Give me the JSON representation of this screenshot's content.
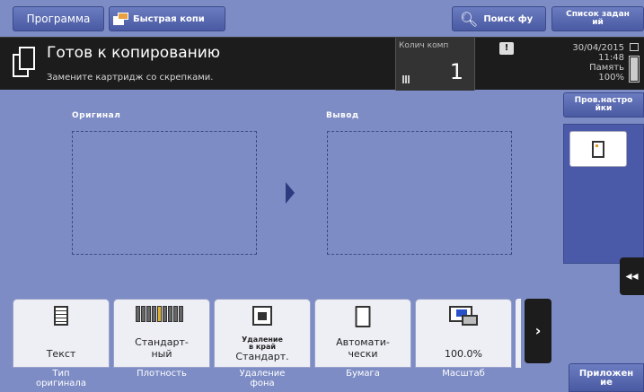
{
  "topbar": {
    "program_label": "Программа",
    "quick_copy_label": "Быстрая копи",
    "search_label": "Поиск фу",
    "job_list_label_1": "Список задан",
    "job_list_label_2": "ий"
  },
  "status": {
    "title": "Готов к копированию",
    "message": "Замените картридж со скрепками.",
    "count_label": "Колич комп",
    "count_value": "1",
    "warning_symbol": "!",
    "date": "30/04/2015",
    "time": "11:48",
    "memory_label": "Память",
    "memory_value": "100%",
    "memory_fraction": 1.0
  },
  "main": {
    "original_label": "Оригинал",
    "output_label": "Вывод"
  },
  "side": {
    "settings_label_1": "Пров.настро",
    "settings_label_2": "йки",
    "collapse_symbol": "◂◂"
  },
  "functions": [
    {
      "name_1": "Тип",
      "name_2": "оригинала",
      "value": "Текст",
      "icon": "text-doc-icon"
    },
    {
      "name_1": "Плотность",
      "name_2": "",
      "value_1": "Стандарт-",
      "value_2": "ный",
      "icon": "density-scale-icon"
    },
    {
      "name_1": "Удаление",
      "name_2": "фона",
      "value_small_1": "Удаление",
      "value_small_2": "в край",
      "value_big": "Стандарт.",
      "icon": "background-removal-icon"
    },
    {
      "name_1": "Бумага",
      "name_2": "",
      "value_1": "Автомати-",
      "value_2": "чески",
      "icon": "paper-icon"
    },
    {
      "name_1": "Масштаб",
      "name_2": "",
      "value": "100.0%",
      "icon": "zoom-icon"
    }
  ],
  "next_symbol": "›",
  "apps_label_1": "Приложен",
  "apps_label_2": "ие",
  "colors": {
    "background": "#7d8cc4",
    "status_bar": "#1c1c1c",
    "button": "#4a5aa3",
    "accent": "#e0b030"
  }
}
